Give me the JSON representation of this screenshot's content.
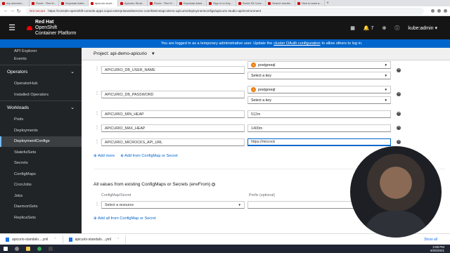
{
  "browser": {
    "tabs": [
      {
        "label": "my-microshi..."
      },
      {
        "label": "Route · Red H..."
      },
      {
        "label": "Keycloak Admi..."
      },
      {
        "label": "apicurio-studi..."
      },
      {
        "label": "Apicurio Studi..."
      },
      {
        "label": "Route · Red H..."
      },
      {
        "label": "Keycloak Admi..."
      },
      {
        "label": "Sign in to Key..."
      },
      {
        "label": "Route 53 Cons..."
      },
      {
        "label": "Search results..."
      },
      {
        "label": "How to want a..."
      }
    ],
    "url_security": "Not secure",
    "url": "https://console-openshift-console.apps.ocpai.enterprisewebservice.com/k8s/ns/api-demo-apicurio/deploymentconfigs/apicurio-studio-api/environment"
  },
  "masthead": {
    "brand_line1": "Red Hat",
    "brand_line2": "OpenShift",
    "brand_line3": "Container Platform",
    "notifications_count": "7",
    "user": "kube:admin"
  },
  "infobar": {
    "text_before": "You are logged in as a temporary administrative user. Update the",
    "link": "cluster OAuth configuration",
    "text_after": "to allow others to log in."
  },
  "sidebar": {
    "top_items": [
      "API Explorer",
      "Events"
    ],
    "operators": {
      "label": "Operators",
      "items": [
        "OperatorHub",
        "Installed Operators"
      ]
    },
    "workloads": {
      "label": "Workloads",
      "items": [
        "Pods",
        "Deployments",
        "DeploymentConfigs",
        "StatefulSets",
        "Secrets",
        "ConfigMaps",
        "CronJobs",
        "Jobs",
        "DaemonSets",
        "ReplicaSets"
      ]
    }
  },
  "project": {
    "label": "Project: api-demo-apicurio"
  },
  "env_vars": [
    {
      "name": "APICURIO_DB_USER_NAME",
      "resource": "postgresql",
      "key_placeholder": "Select a key"
    },
    {
      "name": "APICURIO_DB_PASSWORD",
      "resource": "postgresql",
      "key_placeholder": "Select a key"
    },
    {
      "name": "APICURIO_MIN_HEAP",
      "value": "512m"
    },
    {
      "name": "APICURIO_MAX_HEAP",
      "value": "1400m"
    },
    {
      "name": "APICURIO_MICROCKS_API_URL",
      "value": "https://microck"
    }
  ],
  "actions": {
    "add_more": "Add more",
    "add_from": "Add from ConfigMap or Secret"
  },
  "envfrom": {
    "title": "All values from existing ConfigMaps or Secrets (envFrom)",
    "col_resource": "ConfigMap/Secret",
    "col_prefix": "Prefix (optional)",
    "select_placeholder": "Select a resource",
    "add_all": "Add all from ConfigMap or Secret"
  },
  "downloads": {
    "files": [
      "apicurio-standalo....yml",
      "apicurio-standalo....yml"
    ],
    "show_all": "Show all"
  },
  "taskbar": {
    "time": "3:08 PM",
    "date": "6/25/2021"
  }
}
